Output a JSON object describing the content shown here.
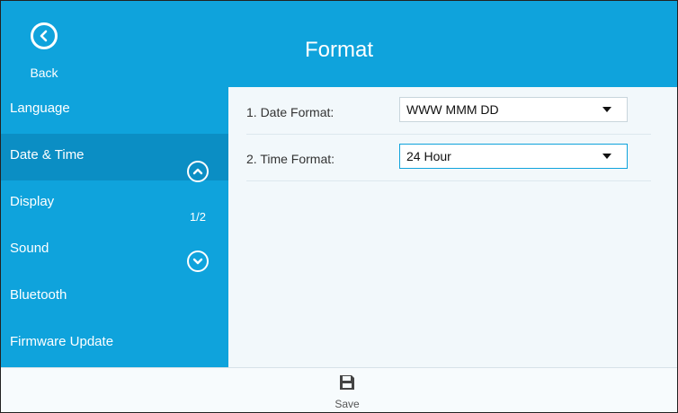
{
  "header": {
    "title": "Format",
    "back_label": "Back"
  },
  "sidebar": {
    "items": [
      {
        "label": "Language"
      },
      {
        "label": "Date & Time",
        "active": true
      },
      {
        "label": "Display"
      },
      {
        "label": "Sound"
      },
      {
        "label": "Bluetooth"
      },
      {
        "label": "Firmware Update"
      }
    ],
    "page_indicator": "1/2"
  },
  "form": {
    "rows": [
      {
        "label": "1. Date Format:",
        "value": "WWW MMM DD"
      },
      {
        "label": "2. Time Format:",
        "value": "24 Hour"
      }
    ]
  },
  "footer": {
    "save_label": "Save"
  },
  "colors": {
    "accent": "#0fa3dc",
    "active_item": "#0b8ec4",
    "content_bg": "#f2f8fb"
  }
}
